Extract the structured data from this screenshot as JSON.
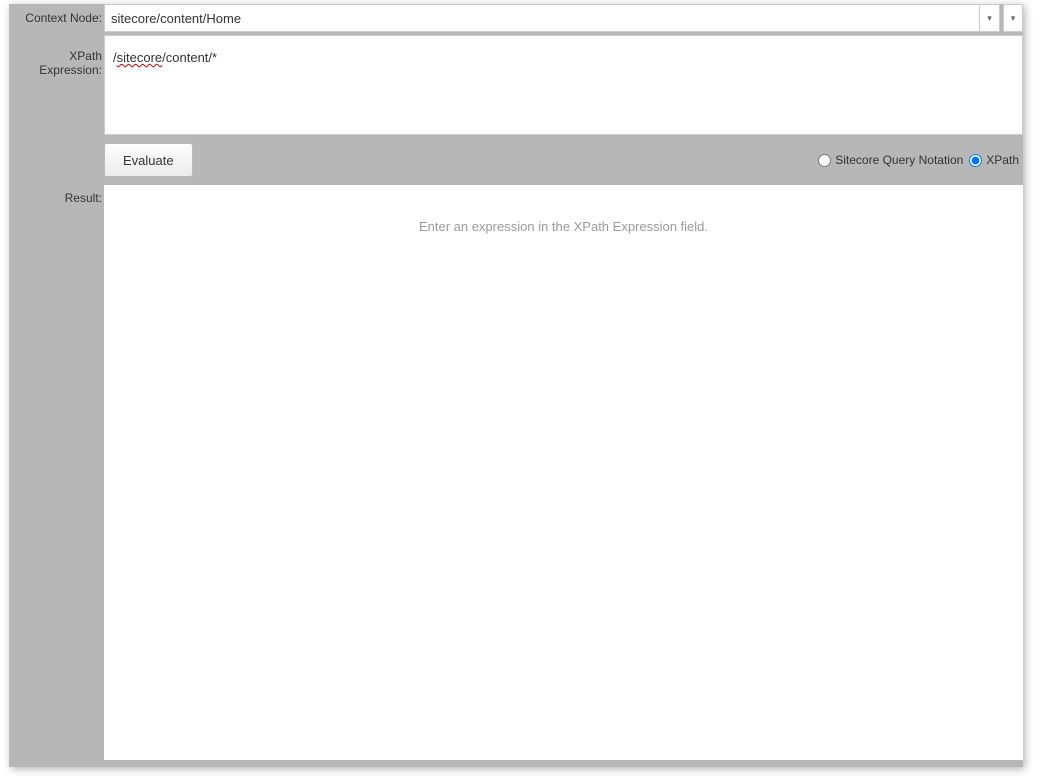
{
  "labels": {
    "context_node": "Context Node:",
    "xpath_expression": "XPath Expression:",
    "result": "Result:"
  },
  "context_node": {
    "value": "sitecore/content/Home"
  },
  "xpath": {
    "prefix": "/",
    "spell": "sitecore",
    "suffix": "/content/*"
  },
  "toolbar": {
    "evaluate_label": "Evaluate"
  },
  "notation": {
    "sitecore_label": "Sitecore Query Notation",
    "xpath_label": "XPath",
    "selected": "xpath"
  },
  "result": {
    "placeholder": "Enter an expression in the XPath Expression field."
  }
}
